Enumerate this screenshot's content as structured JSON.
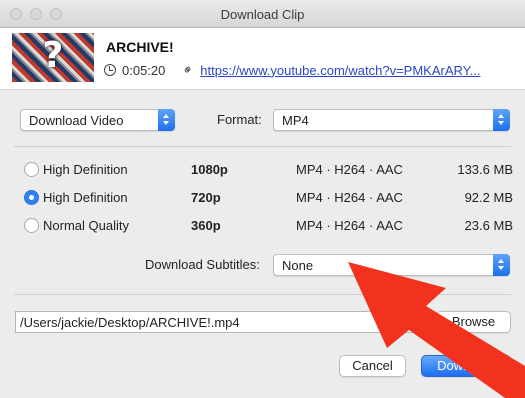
{
  "window": {
    "title": "Download Clip"
  },
  "clip": {
    "title": "ARCHIVE!",
    "duration": "0:05:20",
    "url": "https://www.youtube.com/watch?v=PMKArARY..."
  },
  "mode_popup": {
    "value": "Download Video"
  },
  "format": {
    "label": "Format:",
    "value": "MP4"
  },
  "qualities": [
    {
      "name": "High Definition",
      "resolution": "1080p",
      "codec": "MP4 · H264 · AAC",
      "size": "133.6 MB",
      "selected": false
    },
    {
      "name": "High Definition",
      "resolution": "720p",
      "codec": "MP4 · H264 · AAC",
      "size": "92.2 MB",
      "selected": true
    },
    {
      "name": "Normal Quality",
      "resolution": "360p",
      "codec": "MP4 · H264 · AAC",
      "size": "23.6 MB",
      "selected": false
    }
  ],
  "subtitles": {
    "label": "Download Subtitles:",
    "value": "None"
  },
  "save_path": {
    "value": "/Users/jackie/Desktop/ARCHIVE!.mp4"
  },
  "buttons": {
    "browse": "Browse",
    "cancel": "Cancel",
    "download": "Download"
  },
  "annotation": {
    "arrow_color": "#f2311e"
  },
  "colors": {
    "accent": "#1d6ff0",
    "link": "#2a47c9"
  }
}
